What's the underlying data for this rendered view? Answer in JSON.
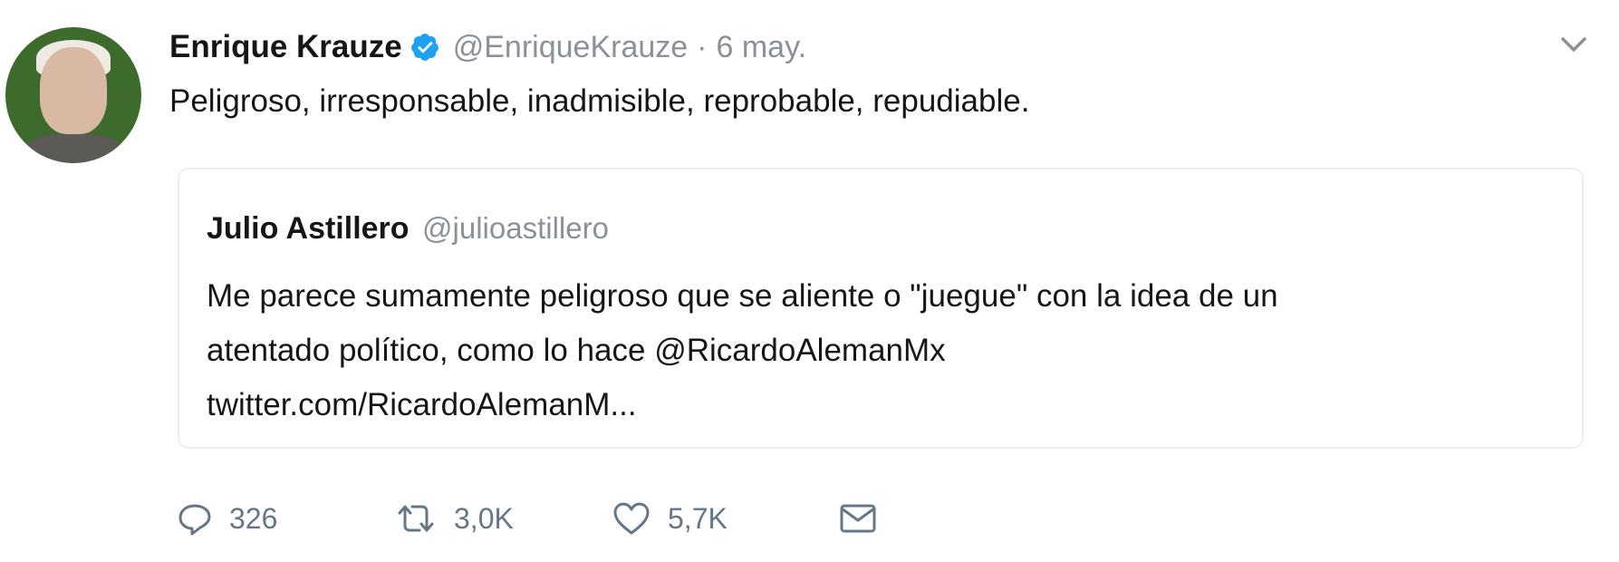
{
  "tweet": {
    "author_name": "Enrique Krauze",
    "author_handle": "@EnriqueKrauze",
    "separator": "·",
    "time": "6 may.",
    "text": "Peligroso, irresponsable, inadmisible, reprobable, repudiable.",
    "verified_icon": "verified-badge-icon",
    "menu_icon": "chevron-down-icon"
  },
  "quoted_tweet": {
    "author_name": "Julio Astillero",
    "author_handle": "@julioastillero",
    "text_lines": [
      "Me parece sumamente peligroso que se aliente o \"juegue\" con la idea de un",
      "atentado político, como lo hace @RicardoAlemanMx",
      "twitter.com/RicardoAlemanM..."
    ]
  },
  "actions": {
    "reply_count": "326",
    "retweet_count": "3,0K",
    "like_count": "5,7K",
    "reply_icon": "reply-icon",
    "retweet_icon": "retweet-icon",
    "like_icon": "heart-icon",
    "message_icon": "direct-message-icon"
  },
  "colors": {
    "verified_blue": "#1da1f2",
    "muted_text": "#8a9199",
    "action_gray": "#657786",
    "border": "#eceff2"
  }
}
